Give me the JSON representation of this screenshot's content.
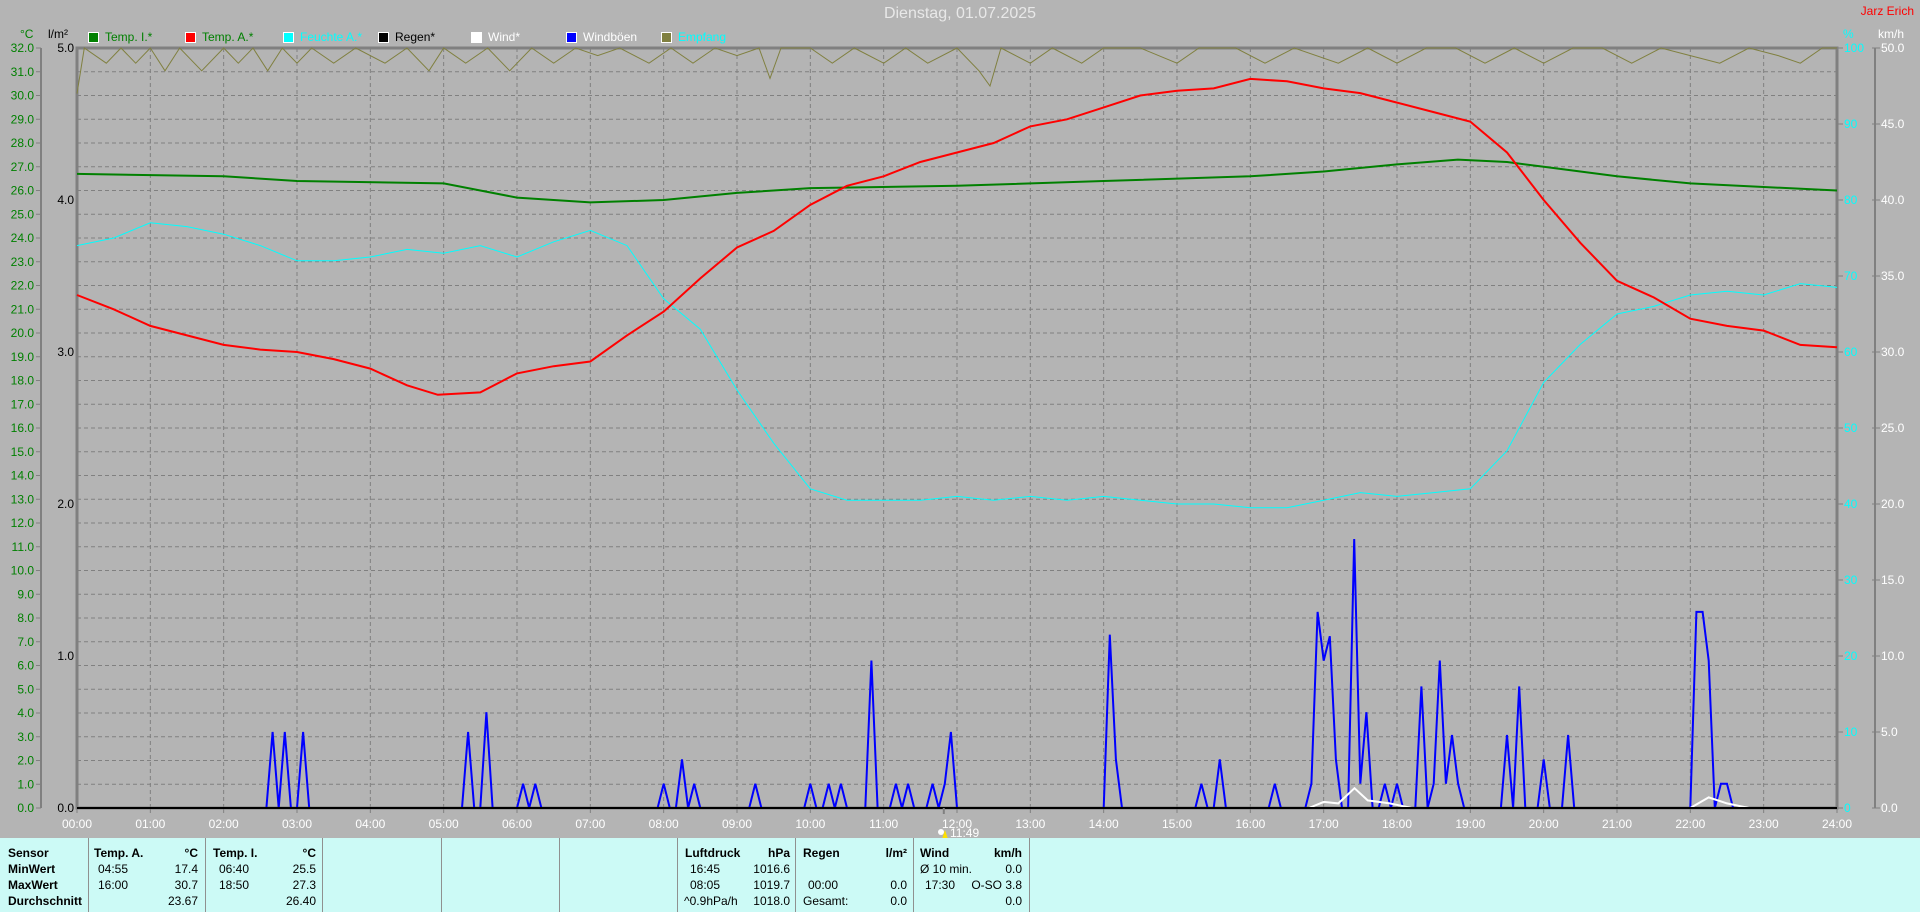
{
  "title": "Dienstag, 01.07.2025",
  "author": "Jarz Erich",
  "units": {
    "temp": "°C",
    "rain": "l/m²",
    "humidity": "%",
    "wind": "km/h"
  },
  "legend": [
    {
      "label": "Temp. I.*",
      "color": "#008000",
      "text_color": "#008000"
    },
    {
      "label": "Temp. A.*",
      "color": "#ff0000",
      "text_color": "#008000"
    },
    {
      "label": "Feuchte A.*",
      "color": "#00ffff",
      "text_color": "#00ffff"
    },
    {
      "label": "Regen*",
      "color": "#000000",
      "text_color": "#000000"
    },
    {
      "label": "Wind*",
      "color": "#ffffff",
      "text_color": "#ffffff"
    },
    {
      "label": "Windböen",
      "color": "#0000ff",
      "text_color": "#ffffff"
    },
    {
      "label": "Empfang",
      "color": "#808040",
      "text_color": "#00ffff"
    }
  ],
  "marker": {
    "time_label": "11:49",
    "time": 11.82
  },
  "chart_data": {
    "type": "line",
    "x_ticks": [
      "00:00",
      "01:00",
      "02:00",
      "03:00",
      "04:00",
      "05:00",
      "06:00",
      "07:00",
      "08:00",
      "09:00",
      "10:00",
      "11:00",
      "12:00",
      "13:00",
      "14:00",
      "15:00",
      "16:00",
      "17:00",
      "18:00",
      "19:00",
      "20:00",
      "21:00",
      "22:00",
      "23:00",
      "24:00"
    ],
    "xlim": [
      0,
      24
    ],
    "axes": {
      "temp": {
        "range": [
          0,
          32
        ],
        "ticks": [
          "0.0",
          "1.0",
          "2.0",
          "3.0",
          "4.0",
          "5.0",
          "6.0",
          "7.0",
          "8.0",
          "9.0",
          "10.0",
          "11.0",
          "12.0",
          "13.0",
          "14.0",
          "15.0",
          "16.0",
          "17.0",
          "18.0",
          "19.0",
          "20.0",
          "21.0",
          "22.0",
          "23.0",
          "24.0",
          "25.0",
          "26.0",
          "27.0",
          "28.0",
          "29.0",
          "30.0",
          "31.0",
          "32.0"
        ]
      },
      "rain": {
        "range": [
          0,
          5
        ],
        "ticks": [
          "0.0",
          "1.0",
          "2.0",
          "3.0",
          "4.0",
          "5.0"
        ]
      },
      "humidity": {
        "range": [
          0,
          100
        ],
        "ticks": [
          "0",
          "10",
          "20",
          "30",
          "40",
          "50",
          "60",
          "70",
          "80",
          "90",
          "100"
        ]
      },
      "wind": {
        "range": [
          0,
          50
        ],
        "ticks": [
          "0.0",
          "5.0",
          "10.0",
          "15.0",
          "20.0",
          "25.0",
          "30.0",
          "35.0",
          "40.0",
          "45.0",
          "50.0"
        ]
      }
    },
    "series": [
      {
        "name": "Temp. A.",
        "axis": "temp",
        "color": "#ff0000",
        "points": [
          [
            0,
            21.6
          ],
          [
            0.5,
            21.0
          ],
          [
            1,
            20.3
          ],
          [
            1.5,
            19.9
          ],
          [
            2,
            19.5
          ],
          [
            2.5,
            19.3
          ],
          [
            3,
            19.2
          ],
          [
            3.5,
            18.9
          ],
          [
            4,
            18.5
          ],
          [
            4.5,
            17.8
          ],
          [
            4.92,
            17.4
          ],
          [
            5.5,
            17.5
          ],
          [
            6,
            18.3
          ],
          [
            6.5,
            18.6
          ],
          [
            7,
            18.8
          ],
          [
            7.5,
            19.9
          ],
          [
            8,
            20.9
          ],
          [
            8.5,
            22.3
          ],
          [
            9,
            23.6
          ],
          [
            9.5,
            24.3
          ],
          [
            10,
            25.4
          ],
          [
            10.5,
            26.2
          ],
          [
            11,
            26.6
          ],
          [
            11.5,
            27.2
          ],
          [
            12,
            27.6
          ],
          [
            12.5,
            28.0
          ],
          [
            13,
            28.7
          ],
          [
            13.5,
            29.0
          ],
          [
            14,
            29.5
          ],
          [
            14.5,
            30.0
          ],
          [
            15,
            30.2
          ],
          [
            15.5,
            30.3
          ],
          [
            16,
            30.7
          ],
          [
            16.5,
            30.6
          ],
          [
            17,
            30.3
          ],
          [
            17.5,
            30.1
          ],
          [
            18,
            29.7
          ],
          [
            18.5,
            29.3
          ],
          [
            19,
            28.9
          ],
          [
            19.5,
            27.6
          ],
          [
            20,
            25.6
          ],
          [
            20.5,
            23.8
          ],
          [
            21,
            22.2
          ],
          [
            21.5,
            21.5
          ],
          [
            22,
            20.6
          ],
          [
            22.5,
            20.3
          ],
          [
            23,
            20.1
          ],
          [
            23.5,
            19.5
          ],
          [
            24,
            19.4
          ]
        ]
      },
      {
        "name": "Temp. I.",
        "axis": "temp",
        "color": "#008000",
        "points": [
          [
            0,
            26.7
          ],
          [
            2,
            26.6
          ],
          [
            3,
            26.4
          ],
          [
            5,
            26.3
          ],
          [
            5.5,
            26.0
          ],
          [
            6,
            25.7
          ],
          [
            7,
            25.5
          ],
          [
            8,
            25.6
          ],
          [
            9,
            25.9
          ],
          [
            10,
            26.1
          ],
          [
            12,
            26.2
          ],
          [
            14,
            26.4
          ],
          [
            16,
            26.6
          ],
          [
            17,
            26.8
          ],
          [
            18,
            27.1
          ],
          [
            18.83,
            27.3
          ],
          [
            19.5,
            27.2
          ],
          [
            20,
            27.0
          ],
          [
            21,
            26.6
          ],
          [
            22,
            26.3
          ],
          [
            24,
            26.0
          ]
        ]
      },
      {
        "name": "Feuchte A.",
        "axis": "humidity",
        "color": "#00ffff",
        "points": [
          [
            0,
            74
          ],
          [
            0.5,
            75
          ],
          [
            1,
            77
          ],
          [
            1.5,
            76.5
          ],
          [
            2,
            75.5
          ],
          [
            2.5,
            74
          ],
          [
            3,
            72
          ],
          [
            3.5,
            72
          ],
          [
            4,
            72.5
          ],
          [
            4.5,
            73.5
          ],
          [
            5,
            73
          ],
          [
            5.5,
            74
          ],
          [
            6,
            72.5
          ],
          [
            6.5,
            74.5
          ],
          [
            7,
            76
          ],
          [
            7.5,
            74
          ],
          [
            8,
            67
          ],
          [
            8.5,
            63
          ],
          [
            9,
            55
          ],
          [
            9.5,
            48
          ],
          [
            10,
            42
          ],
          [
            10.5,
            40.5
          ],
          [
            11,
            40.5
          ],
          [
            11.5,
            40.5
          ],
          [
            12,
            41
          ],
          [
            12.5,
            40.5
          ],
          [
            13,
            41
          ],
          [
            13.5,
            40.5
          ],
          [
            14,
            41
          ],
          [
            14.5,
            40.5
          ],
          [
            15,
            40
          ],
          [
            15.5,
            40
          ],
          [
            16,
            39.5
          ],
          [
            16.5,
            39.5
          ],
          [
            17,
            40.5
          ],
          [
            17.5,
            41.5
          ],
          [
            18,
            41
          ],
          [
            18.5,
            41.5
          ],
          [
            19,
            42
          ],
          [
            19.5,
            47
          ],
          [
            20,
            56
          ],
          [
            20.5,
            61
          ],
          [
            21,
            65
          ],
          [
            21.5,
            66
          ],
          [
            22,
            67.5
          ],
          [
            22.5,
            68
          ],
          [
            23,
            67.5
          ],
          [
            23.5,
            69
          ],
          [
            24,
            68.5
          ]
        ]
      },
      {
        "name": "Windböen",
        "axis": "wind",
        "color": "#0000ff",
        "spikes": [
          [
            2.67,
            5
          ],
          [
            2.83,
            5
          ],
          [
            3.08,
            5
          ],
          [
            5.33,
            5
          ],
          [
            5.58,
            6.3
          ],
          [
            6.08,
            1.6
          ],
          [
            6.25,
            1.6
          ],
          [
            8.0,
            1.6
          ],
          [
            8.25,
            3.2
          ],
          [
            8.42,
            1.6
          ],
          [
            9.25,
            1.6
          ],
          [
            10.0,
            1.6
          ],
          [
            10.25,
            1.6
          ],
          [
            10.42,
            1.6
          ],
          [
            10.83,
            9.7
          ],
          [
            11.17,
            1.6
          ],
          [
            11.33,
            1.6
          ],
          [
            11.67,
            1.6
          ],
          [
            11.83,
            1.6
          ],
          [
            11.92,
            5
          ],
          [
            14.08,
            11.4
          ],
          [
            14.17,
            3.2
          ],
          [
            15.33,
            1.6
          ],
          [
            15.58,
            3.2
          ],
          [
            16.33,
            1.6
          ],
          [
            16.83,
            1.6
          ],
          [
            16.92,
            12.9
          ],
          [
            17.0,
            9.7
          ],
          [
            17.08,
            11.3
          ],
          [
            17.17,
            3.2
          ],
          [
            17.42,
            17.7
          ],
          [
            17.5,
            1.6
          ],
          [
            17.58,
            6.3
          ],
          [
            17.83,
            1.6
          ],
          [
            18.0,
            1.6
          ],
          [
            18.33,
            8.0
          ],
          [
            18.5,
            1.6
          ],
          [
            18.58,
            9.7
          ],
          [
            18.67,
            1.6
          ],
          [
            18.75,
            4.8
          ],
          [
            18.83,
            1.6
          ],
          [
            19.5,
            4.8
          ],
          [
            19.67,
            8.0
          ],
          [
            20.0,
            3.2
          ],
          [
            20.33,
            4.8
          ],
          [
            22.08,
            12.9
          ],
          [
            22.17,
            12.9
          ],
          [
            22.25,
            9.7
          ],
          [
            22.42,
            1.6
          ],
          [
            22.5,
            1.6
          ]
        ]
      },
      {
        "name": "Wind",
        "axis": "wind",
        "color": "#ffffff",
        "points": [
          [
            16.8,
            0
          ],
          [
            17.0,
            0.4
          ],
          [
            17.2,
            0.3
          ],
          [
            17.42,
            1.3
          ],
          [
            17.6,
            0.5
          ],
          [
            17.9,
            0.3
          ],
          [
            18.2,
            0
          ],
          [
            22.0,
            0
          ],
          [
            22.25,
            0.7
          ],
          [
            22.5,
            0.3
          ],
          [
            22.8,
            0
          ]
        ]
      },
      {
        "name": "Regen",
        "axis": "rain",
        "color": "#000000",
        "points": [
          [
            0,
            0
          ],
          [
            24,
            0
          ]
        ]
      },
      {
        "name": "Empfang",
        "axis": "humidity",
        "color": "#808040",
        "points": [
          [
            0,
            94
          ],
          [
            0.1,
            100
          ],
          [
            0.4,
            98
          ],
          [
            0.6,
            100
          ],
          [
            0.8,
            98
          ],
          [
            1,
            100
          ],
          [
            1.2,
            97
          ],
          [
            1.4,
            100
          ],
          [
            1.7,
            97
          ],
          [
            2,
            100
          ],
          [
            2.2,
            98
          ],
          [
            2.4,
            100
          ],
          [
            2.6,
            97
          ],
          [
            2.8,
            100
          ],
          [
            3,
            98
          ],
          [
            3.2,
            100
          ],
          [
            3.5,
            98
          ],
          [
            3.8,
            100
          ],
          [
            4.2,
            98
          ],
          [
            4.5,
            100
          ],
          [
            4.8,
            97
          ],
          [
            5,
            100
          ],
          [
            5.3,
            98
          ],
          [
            5.6,
            100
          ],
          [
            5.9,
            97
          ],
          [
            6.2,
            100
          ],
          [
            6.5,
            98
          ],
          [
            6.8,
            100
          ],
          [
            7.1,
            99
          ],
          [
            7.4,
            100
          ],
          [
            7.8,
            98
          ],
          [
            8.1,
            100
          ],
          [
            8.4,
            98
          ],
          [
            8.7,
            100
          ],
          [
            9,
            99
          ],
          [
            9.3,
            100
          ],
          [
            9.45,
            96
          ],
          [
            9.6,
            100
          ],
          [
            10,
            100
          ],
          [
            10.3,
            98
          ],
          [
            10.6,
            100
          ],
          [
            11,
            98
          ],
          [
            11.3,
            100
          ],
          [
            11.6,
            98
          ],
          [
            12,
            100
          ],
          [
            12.3,
            97
          ],
          [
            12.45,
            95
          ],
          [
            12.6,
            100
          ],
          [
            13,
            98
          ],
          [
            13.3,
            100
          ],
          [
            13.7,
            98
          ],
          [
            14,
            100
          ],
          [
            14.5,
            100
          ],
          [
            15,
            98
          ],
          [
            15.3,
            100
          ],
          [
            15.8,
            100
          ],
          [
            16.2,
            98
          ],
          [
            16.6,
            100
          ],
          [
            17.2,
            98
          ],
          [
            17.6,
            100
          ],
          [
            18,
            98
          ],
          [
            18.4,
            100
          ],
          [
            18.8,
            100
          ],
          [
            19.2,
            98
          ],
          [
            19.6,
            100
          ],
          [
            20,
            98
          ],
          [
            20.4,
            100
          ],
          [
            20.8,
            100
          ],
          [
            21.2,
            98
          ],
          [
            21.6,
            100
          ],
          [
            22,
            99
          ],
          [
            22.4,
            98
          ],
          [
            22.8,
            100
          ],
          [
            23.2,
            99
          ],
          [
            23.5,
            98
          ],
          [
            23.8,
            100
          ],
          [
            24,
            100
          ]
        ]
      }
    ]
  },
  "table": {
    "row_labels": [
      "Sensor",
      "MinWert",
      "MaxWert",
      "Durchschnitt"
    ],
    "temp_a": {
      "header": "Temp. A.",
      "unit": "°C",
      "min_time": "04:55",
      "min": "17.4",
      "max_time": "16:00",
      "max": "30.7",
      "avg": "23.67"
    },
    "temp_i": {
      "header": "Temp. I.",
      "unit": "°C",
      "min_time": "06:40",
      "min": "25.5",
      "max_time": "18:50",
      "max": "27.3",
      "avg": "26.40"
    },
    "pressure": {
      "header": "Luftdruck",
      "unit": "hPa",
      "min_time": "16:45",
      "min": "1016.6",
      "max_time": "08:05",
      "max": "1019.7",
      "trend": "^0.9hPa/h",
      "avg": "1018.0"
    },
    "rain": {
      "header": "Regen",
      "unit": "l/m²",
      "time": "00:00",
      "value": "0.0",
      "total_label": "Gesamt:",
      "total": "0.0"
    },
    "wind": {
      "header": "Wind",
      "unit": "km/h",
      "avg_label": "Ø 10 min.",
      "avg": "0.0",
      "max_time": "17:30",
      "max": "O-SO 3.8",
      "mean": "0.0"
    }
  }
}
